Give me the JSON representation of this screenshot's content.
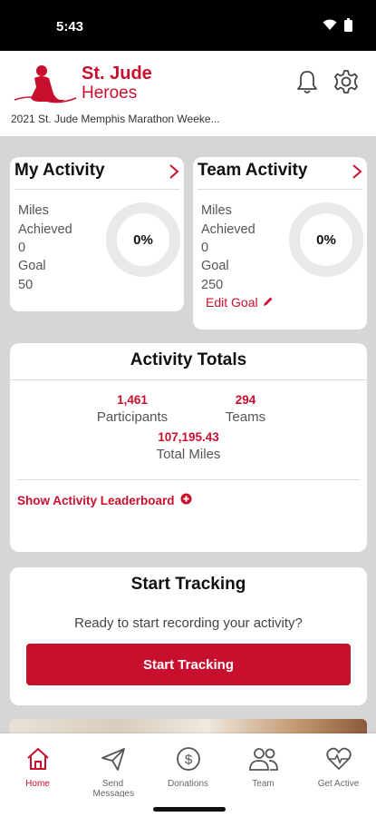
{
  "status": {
    "time": "5:43"
  },
  "header": {
    "logo_title": "St. Jude",
    "logo_subtitle": "Heroes",
    "event_name": "2021 St. Jude Memphis Marathon Weeke..."
  },
  "my_activity": {
    "title": "My Activity",
    "achieved_label_1": "Miles",
    "achieved_label_2": "Achieved",
    "achieved_value": "0",
    "goal_label": "Goal",
    "goal_value": "50",
    "progress_label": "0%",
    "progress": 0
  },
  "team_activity": {
    "title": "Team Activity",
    "achieved_label_1": "Miles",
    "achieved_label_2": "Achieved",
    "achieved_value": "0",
    "goal_label": "Goal",
    "goal_value": "250",
    "progress_label": "0%",
    "progress": 0,
    "edit_goal_label": "Edit Goal"
  },
  "totals": {
    "title": "Activity Totals",
    "participants_value": "1,461",
    "participants_label": "Participants",
    "teams_value": "294",
    "teams_label": "Teams",
    "miles_value": "107,195.43",
    "miles_label": "Total Miles",
    "leaderboard_link": "Show Activity Leaderboard"
  },
  "tracking": {
    "title": "Start Tracking",
    "prompt": "Ready to start recording your activity?",
    "button_label": "Start Tracking"
  },
  "nav": {
    "items": [
      {
        "label": "Home",
        "icon": "home-icon",
        "active": true
      },
      {
        "label": "Send Messages",
        "icon": "paper-plane-icon",
        "active": false
      },
      {
        "label": "Donations",
        "icon": "dollar-icon",
        "active": false
      },
      {
        "label": "Team",
        "icon": "team-icon",
        "active": false
      },
      {
        "label": "Get Active",
        "icon": "heart-pulse-icon",
        "active": false
      }
    ]
  },
  "colors": {
    "brand": "#c8102e",
    "background": "#d6d6d6",
    "ring": "#e9e9e9"
  }
}
